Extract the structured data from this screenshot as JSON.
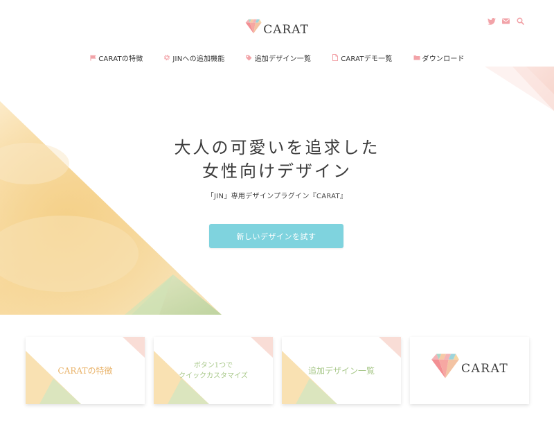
{
  "header": {
    "logo_text": "CARAT",
    "social_icons": [
      "twitter-icon",
      "mail-icon",
      "search-icon"
    ],
    "icon_color": "#f2a3a8"
  },
  "nav": {
    "items": [
      {
        "label": "CARATの特徴",
        "icon": "flag-icon"
      },
      {
        "label": "JINへの追加機能",
        "icon": "gear-icon"
      },
      {
        "label": "追加デザイン一覧",
        "icon": "tag-icon"
      },
      {
        "label": "CARATデモ一覧",
        "icon": "document-icon"
      },
      {
        "label": "ダウンロード",
        "icon": "folder-icon"
      }
    ],
    "icon_color": "#f2a3a8"
  },
  "hero": {
    "title_line1": "大人の可愛いを追求した",
    "title_line2": "女性向けデザイン",
    "subtitle": "「JIN」専用デザインプラグイン『CARAT』",
    "cta_label": "新しいデザインを試す",
    "cta_color": "#7fd3de"
  },
  "cards": [
    {
      "label": "CARATの特徴"
    },
    {
      "label_line1": "ボタン1つで",
      "label_line2": "クイックカスタマイズ"
    },
    {
      "label": "追加デザイン一覧"
    },
    {
      "logo_text": "CARAT"
    }
  ]
}
